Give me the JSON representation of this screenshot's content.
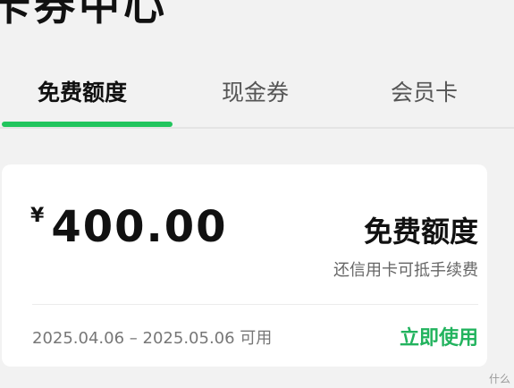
{
  "header": {
    "title": "卡券中心"
  },
  "tabs": [
    {
      "label": "免费额度",
      "active": true
    },
    {
      "label": "现金券",
      "active": false
    },
    {
      "label": "会员卡",
      "active": false
    }
  ],
  "card": {
    "currency": "¥",
    "amount": "400.00",
    "title": "免费额度",
    "description": "还信用卡可抵手续费",
    "validity": "2025.04.06 – 2025.05.06 可用",
    "action_label": "立即使用"
  },
  "watermark": "什么",
  "colors": {
    "accent": "#22c55e",
    "action_text": "#22b35e",
    "background": "#f2f2f2",
    "card_background": "#ffffff"
  }
}
